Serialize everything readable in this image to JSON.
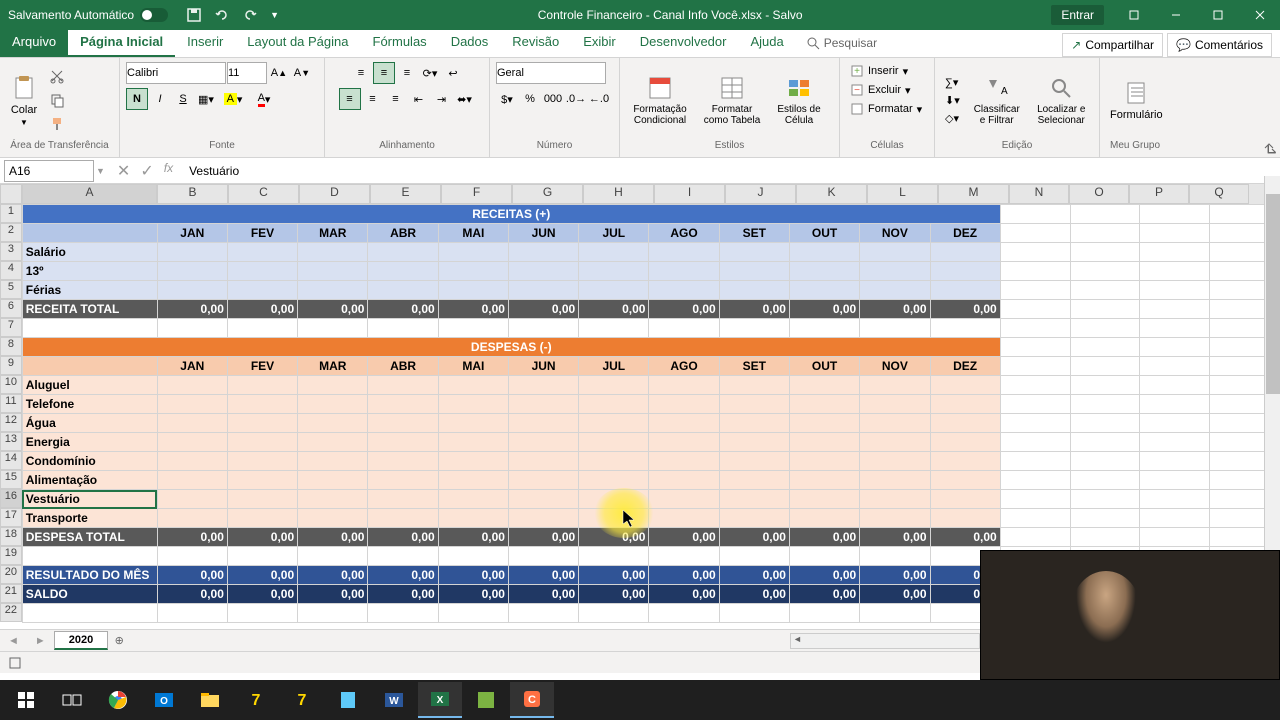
{
  "titlebar": {
    "autosave": "Salvamento Automático",
    "title": "Controle Financeiro - Canal Info Você.xlsx - Salvo",
    "signin": "Entrar"
  },
  "tabs": {
    "file": "Arquivo",
    "home": "Página Inicial",
    "insert": "Inserir",
    "layout": "Layout da Página",
    "formulas": "Fórmulas",
    "data": "Dados",
    "review": "Revisão",
    "view": "Exibir",
    "developer": "Desenvolvedor",
    "help": "Ajuda",
    "search": "Pesquisar",
    "share": "Compartilhar",
    "comments": "Comentários"
  },
  "ribbon": {
    "clipboard": {
      "paste": "Colar",
      "label": "Área de Transferência"
    },
    "font": {
      "name": "Calibri",
      "size": "11",
      "label": "Fonte"
    },
    "align": {
      "label": "Alinhamento"
    },
    "number": {
      "format": "Geral",
      "label": "Número"
    },
    "styles": {
      "cond": "Formatação Condicional",
      "table": "Formatar como Tabela",
      "cell": "Estilos de Célula",
      "label": "Estilos"
    },
    "cells": {
      "insert": "Inserir",
      "delete": "Excluir",
      "format": "Formatar",
      "label": "Células"
    },
    "editing": {
      "sort": "Classificar e Filtrar",
      "find": "Localizar e Selecionar",
      "label": "Edição"
    },
    "mygroup": {
      "form": "Formulário",
      "label": "Meu Grupo"
    }
  },
  "formula": {
    "ref": "A16",
    "value": "Vestuário"
  },
  "columns": [
    "A",
    "B",
    "C",
    "D",
    "E",
    "F",
    "G",
    "H",
    "I",
    "J",
    "K",
    "L",
    "M",
    "N",
    "O",
    "P",
    "Q"
  ],
  "months": [
    "JAN",
    "FEV",
    "MAR",
    "ABR",
    "MAI",
    "JUN",
    "JUL",
    "AGO",
    "SET",
    "OUT",
    "NOV",
    "DEZ"
  ],
  "sheet": {
    "receitas_title": "RECEITAS (+)",
    "despesas_title": "DESPESAS (-)",
    "receita_rows": [
      "Salário",
      "13º",
      "Férias"
    ],
    "receita_total": "RECEITA TOTAL",
    "despesa_rows": [
      "Aluguel",
      "Telefone",
      "Água",
      "Energia",
      "Condomínio",
      "Alimentação",
      "Vestuário",
      "Transporte"
    ],
    "despesa_total": "DESPESA TOTAL",
    "resultado": "RESULTADO DO MÊS",
    "saldo": "SALDO",
    "zero": "0,00"
  },
  "sheettab": {
    "name": "2020"
  },
  "chart_data": {
    "type": "table",
    "title": "Controle Financeiro",
    "sections": [
      {
        "name": "RECEITAS (+)",
        "rows": [
          "Salário",
          "13º",
          "Férias"
        ],
        "total_row": "RECEITA TOTAL",
        "values_all": 0.0
      },
      {
        "name": "DESPESAS (-)",
        "rows": [
          "Aluguel",
          "Telefone",
          "Água",
          "Energia",
          "Condomínio",
          "Alimentação",
          "Vestuário",
          "Transporte"
        ],
        "total_row": "DESPESA TOTAL",
        "values_all": 0.0
      }
    ],
    "summary_rows": [
      "RESULTADO DO MÊS",
      "SALDO"
    ],
    "columns": [
      "JAN",
      "FEV",
      "MAR",
      "ABR",
      "MAI",
      "JUN",
      "JUL",
      "AGO",
      "SET",
      "OUT",
      "NOV",
      "DEZ"
    ]
  }
}
